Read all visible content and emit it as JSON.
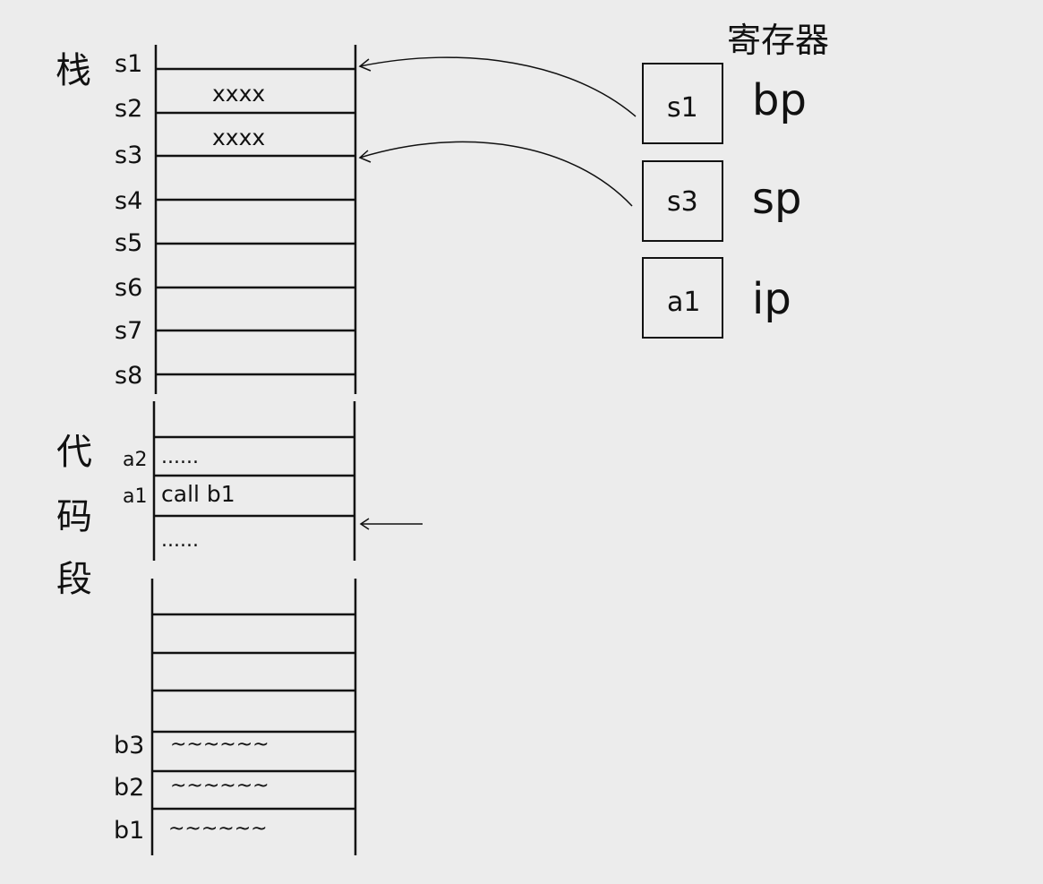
{
  "stack_section": {
    "title": "栈",
    "row_labels": [
      "s1",
      "s2",
      "s3",
      "s4",
      "s5",
      "s6",
      "s7",
      "s8"
    ],
    "cells": [
      "xxxx",
      "xxxx"
    ]
  },
  "code_section": {
    "title": [
      "代",
      "码",
      "段"
    ],
    "row_labels": [
      "a2",
      "a1"
    ],
    "cells": [
      "......",
      "call b1",
      "......"
    ],
    "function_labels": [
      "b3",
      "b2",
      "b1"
    ],
    "function_cells": [
      "~~~~~~",
      "~~~~~~",
      "~~~~~~"
    ]
  },
  "registers": {
    "title": "寄存器",
    "items": [
      {
        "value": "s1",
        "name": "bp"
      },
      {
        "value": "s3",
        "name": "sp"
      },
      {
        "value": "a1",
        "name": "ip"
      }
    ]
  }
}
